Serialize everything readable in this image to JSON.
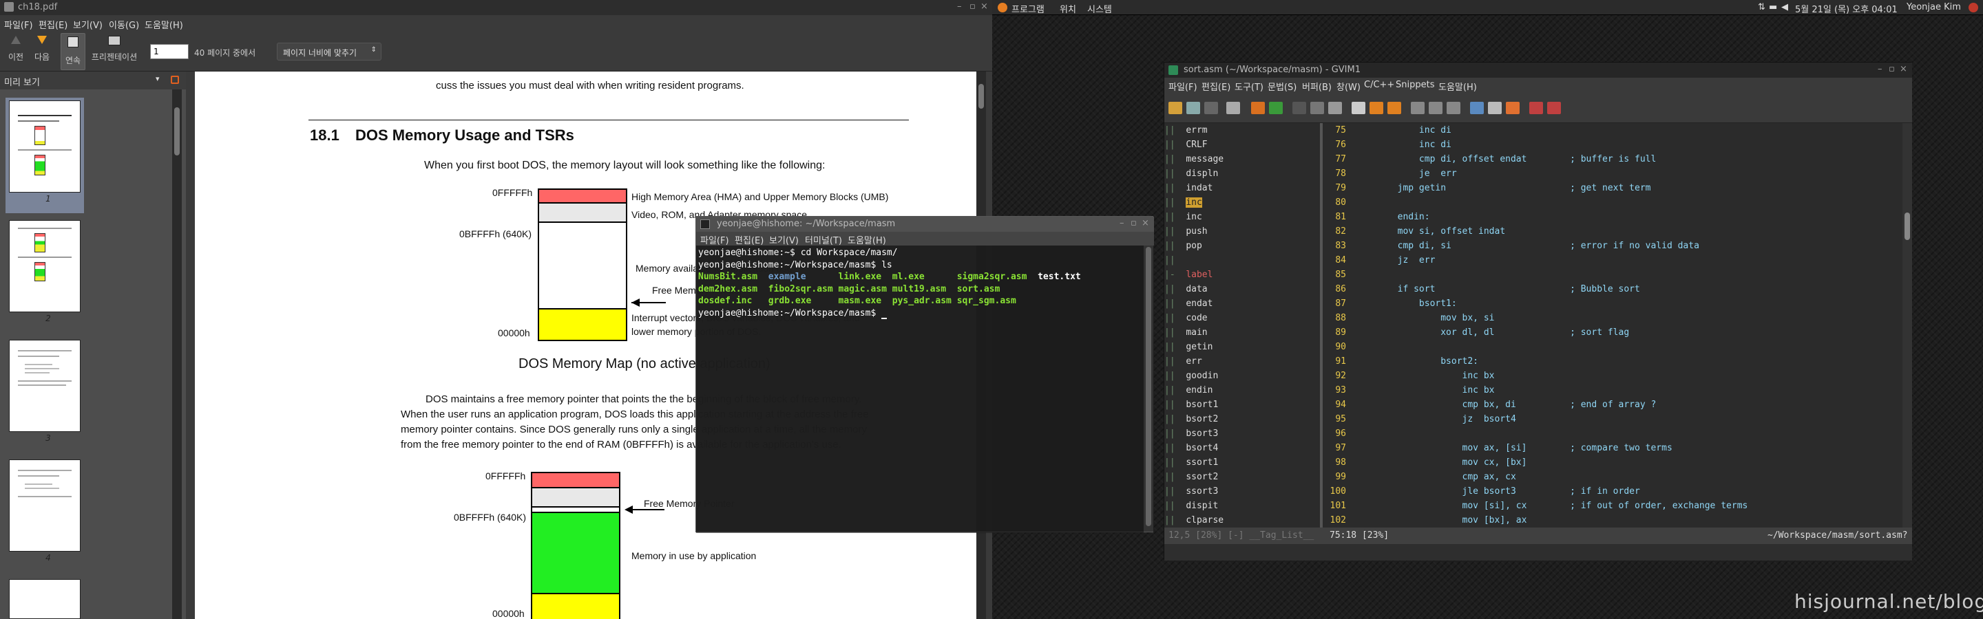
{
  "evince": {
    "title": "ch18.pdf",
    "menu": [
      "파일(F)",
      "편집(E)",
      "보기(V)",
      "이동(G)",
      "도움말(H)"
    ],
    "toolbar": {
      "prev": "이전",
      "next": "다음",
      "continuous": "연속",
      "presentation": "프리젠테이션",
      "page_value": "1",
      "page_of": "40 페이지 중에서",
      "zoom": "페이지 너비에 맞추기"
    },
    "sidebar": {
      "title": "미리 보기",
      "pages": [
        "1",
        "2",
        "3",
        "4"
      ]
    },
    "doc": {
      "top_text": "cuss the issues you must deal with when writing resident programs.",
      "section_num": "18.1",
      "section_title": "DOS Memory Usage and TSRs",
      "p1": "When you first boot DOS, the memory layout will look something like the following:",
      "map1": {
        "addr_top": "0FFFFFh",
        "addr_mid": "0BFFFFh (640K)",
        "addr_bot": "00000h",
        "l1": "High Memory Area (HMA) and Upper Memory Blocks (UMB)",
        "l2": "Video, ROM, and Adapter memory space",
        "l3": "Memory available for application use",
        "l4": "Free Memory Pointer",
        "l5a": "Interrupt vectors, BIOS variables, DOS variables, and",
        "l5b": "lower memory portion of DOS."
      },
      "caption1": "DOS Memory Map (no active application)",
      "p2": [
        "DOS maintains a free memory pointer that points the the beginning of the block of free memory.",
        "When the user runs an application program, DOS loads this application starting at the address the free",
        "memory pointer contains. Since DOS generally runs only a single application at a time, all the memory",
        "from the free memory pointer to the end of RAM (0BFFFFh) is available for the application's use."
      ],
      "map2": {
        "addr_top": "0FFFFFh",
        "addr_mid": "0BFFFFh (640K)",
        "addr_bot": "00000h",
        "l1": "Free Memory Pointer",
        "l2": "Memory in use by application"
      }
    }
  },
  "panel": {
    "apps": "프로그램",
    "places": "위치",
    "system": "시스템",
    "clock": "5월 21일 (목) 오후 04:01",
    "user": "Yeonjae Kim"
  },
  "terminal": {
    "title": "yeonjae@hishome: ~/Workspace/masm",
    "menu": [
      "파일(F)",
      "편집(E)",
      "보기(V)",
      "터미널(T)",
      "도움말(H)"
    ],
    "lines": [
      "yeonjae@hishome:~$ cd Workspace/masm/",
      "yeonjae@hishome:~/Workspace/masm$ ls"
    ],
    "ls": [
      [
        "NumsBit.asm",
        "example",
        "link.exe",
        "ml.exe",
        "sigma2sqr.asm",
        "test.txt"
      ],
      [
        "dem2hex.asm",
        "fibo2sqr.asm",
        "magic.asm",
        "mult19.asm",
        "sort.asm",
        ""
      ],
      [
        "dosdef.inc",
        "grdb.exe",
        "masm.exe",
        "pys_adr.asm",
        "sqr_sgm.asm",
        ""
      ]
    ],
    "prompt": "yeonjae@hishome:~/Workspace/masm$ ",
    "colors": {
      "exe": "#8ae234",
      "asm": "#8ae234",
      "dir": "#729fcf",
      "txt": "#ffffff"
    }
  },
  "gvim": {
    "title": "sort.asm (~/Workspace/masm) - GVIM1",
    "menu": [
      "파일(F)",
      "편집(E)",
      "도구(T)",
      "문법(S)",
      "버퍼(B)",
      "창(W)",
      "C/C++",
      "Snippets",
      "도움말(H)"
    ],
    "tags": [
      "errm",
      "CRLF",
      "message",
      "displn",
      "indat",
      "inc",
      "inc",
      "push",
      "pop",
      "",
      "label",
      "data",
      "endat",
      "code",
      "main",
      "getin",
      "err",
      "goodin",
      "endin",
      "bsort1",
      "bsort2",
      "bsort3",
      "bsort4",
      "ssort1",
      "ssort2",
      "ssort3",
      "dispit",
      "clparse"
    ],
    "code": [
      {
        "n": "75",
        "t": "            inc di"
      },
      {
        "n": "76",
        "t": "            inc di"
      },
      {
        "n": "77",
        "t": "            cmp di, offset endat        ; buffer is full"
      },
      {
        "n": "78",
        "t": "            je  err"
      },
      {
        "n": "79",
        "t": "        jmp getin                       ; get next term"
      },
      {
        "n": "80",
        "t": ""
      },
      {
        "n": "81",
        "t": "        endin:"
      },
      {
        "n": "82",
        "t": "        mov si, offset indat"
      },
      {
        "n": "83",
        "t": "        cmp di, si                      ; error if no valid data"
      },
      {
        "n": "84",
        "t": "        jz  err"
      },
      {
        "n": "85",
        "t": ""
      },
      {
        "n": "86",
        "t": "        if sort                         ; Bubble sort"
      },
      {
        "n": "87",
        "t": "            bsort1:"
      },
      {
        "n": "88",
        "t": "                mov bx, si"
      },
      {
        "n": "89",
        "t": "                xor dl, dl              ; sort flag"
      },
      {
        "n": "90",
        "t": ""
      },
      {
        "n": "91",
        "t": "                bsort2:"
      },
      {
        "n": "92",
        "t": "                    inc bx"
      },
      {
        "n": "93",
        "t": "                    inc bx"
      },
      {
        "n": "94",
        "t": "                    cmp bx, di          ; end of array ?"
      },
      {
        "n": "95",
        "t": "                    jz  bsort4"
      },
      {
        "n": "96",
        "t": ""
      },
      {
        "n": "97",
        "t": "                    mov ax, [si]        ; compare two terms"
      },
      {
        "n": "98",
        "t": "                    mov cx, [bx]"
      },
      {
        "n": "99",
        "t": "                    cmp ax, cx"
      },
      {
        "n": "100",
        "t": "                    jle bsort3          ; if in order"
      },
      {
        "n": "101",
        "t": "                    mov [si], cx        ; if out of order, exchange terms"
      },
      {
        "n": "102",
        "t": "                    mov [bx], ax"
      }
    ],
    "status_left": "12,5 [28%] [-] __Tag_List__",
    "status_mid": "75:18 [23%]",
    "status_right": "~/Workspace/masm/sort.asm?"
  },
  "watermark": "hisjournal.net/blog"
}
